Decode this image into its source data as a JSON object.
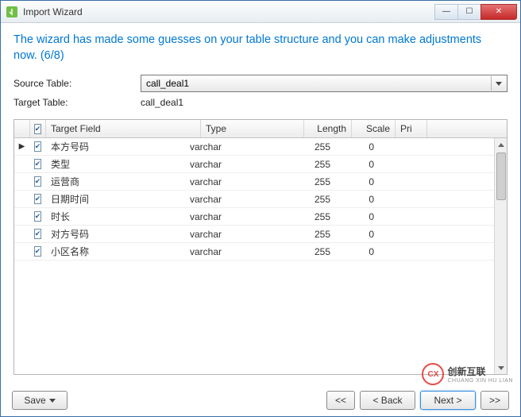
{
  "window": {
    "title": "Import Wizard"
  },
  "heading": "The wizard has made some guesses on your table structure and you can make adjustments now. (6/8)",
  "form": {
    "source_label": "Source Table:",
    "source_value": "call_deal1",
    "target_label": "Target Table:",
    "target_value": "call_deal1"
  },
  "grid": {
    "headers": {
      "target_field": "Target Field",
      "type": "Type",
      "length": "Length",
      "scale": "Scale",
      "primary": "Pri"
    },
    "rows": [
      {
        "checked": true,
        "current": true,
        "field": "本方号码",
        "type": "varchar",
        "length": "255",
        "scale": "0"
      },
      {
        "checked": true,
        "current": false,
        "field": "类型",
        "type": "varchar",
        "length": "255",
        "scale": "0"
      },
      {
        "checked": true,
        "current": false,
        "field": "运营商",
        "type": "varchar",
        "length": "255",
        "scale": "0"
      },
      {
        "checked": true,
        "current": false,
        "field": "日期时间",
        "type": "varchar",
        "length": "255",
        "scale": "0"
      },
      {
        "checked": true,
        "current": false,
        "field": "时长",
        "type": "varchar",
        "length": "255",
        "scale": "0"
      },
      {
        "checked": true,
        "current": false,
        "field": "对方号码",
        "type": "varchar",
        "length": "255",
        "scale": "0"
      },
      {
        "checked": true,
        "current": false,
        "field": "小区名称",
        "type": "varchar",
        "length": "255",
        "scale": "0"
      }
    ]
  },
  "footer": {
    "save": "Save",
    "first": "<<",
    "back": "< Back",
    "next": "Next >",
    "last": ">>"
  },
  "watermark": {
    "logo": "CX",
    "cn": "创新互联",
    "en": "CHUANG XIN HU LIAN"
  }
}
